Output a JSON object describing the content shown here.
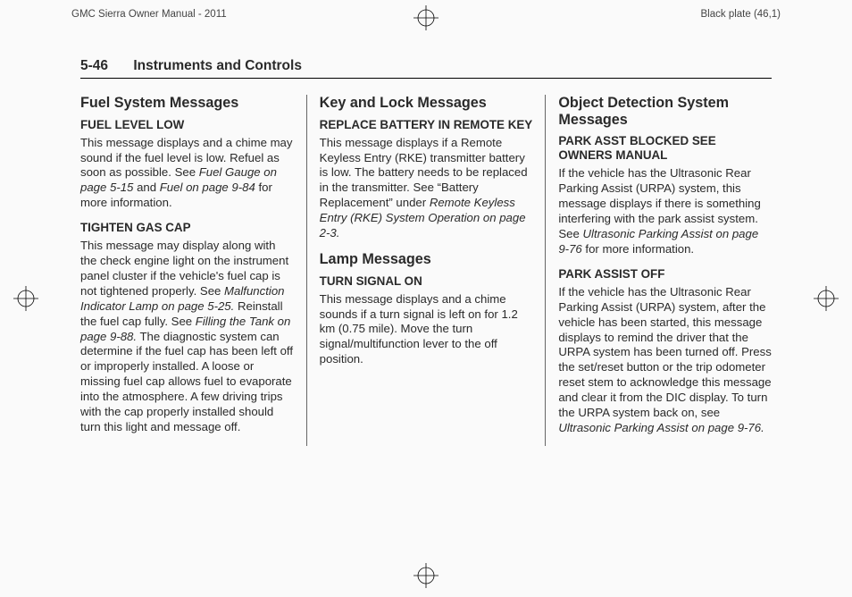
{
  "crop": {
    "left_label": "GMC Sierra Owner Manual - 2011",
    "right_label": "Black plate (46,1)"
  },
  "header": {
    "page_number": "5-46",
    "chapter": "Instruments and Controls"
  },
  "col1": {
    "h2a": "Fuel System Messages",
    "h3a": "FUEL LEVEL LOW",
    "p1a": "This message displays and a chime may sound if the fuel level is low. Refuel as soon as possible. See ",
    "p1_it1": "Fuel Gauge on page 5-15",
    "p1_mid": " and ",
    "p1_it2": "Fuel on page 9-84",
    "p1_end": " for more information.",
    "h3b": "TIGHTEN GAS CAP",
    "p2a": "This message may display along with the check engine light on the instrument panel cluster if the vehicle's fuel cap is not tightened properly. See ",
    "p2_it1": "Malfunction Indicator Lamp on page 5-25.",
    "p2_mid1": " Reinstall the fuel cap fully. See ",
    "p2_it2": "Filling the Tank on page 9-88.",
    "p2_end": " The diagnostic system can determine if the fuel cap has been left off or improperly installed. A loose or missing fuel cap allows fuel to evaporate into the atmosphere. A few driving trips with the cap properly installed should turn this light and message off."
  },
  "col2": {
    "h2a": "Key and Lock Messages",
    "h3a": "REPLACE BATTERY IN REMOTE KEY",
    "p1a": "This message displays if a Remote Keyless Entry (RKE) transmitter battery is low. The battery needs to be replaced in the transmitter. See “Battery Replacement” under ",
    "p1_it1": "Remote Keyless Entry (RKE) System Operation on page 2-3.",
    "h2b": "Lamp Messages",
    "h3b": "TURN SIGNAL ON",
    "p2": "This message displays and a chime sounds if a turn signal is left on for 1.2 km (0.75 mile). Move the turn signal/multifunction lever to the off position."
  },
  "col3": {
    "h2a": "Object Detection System Messages",
    "h3a": "PARK ASST BLOCKED SEE OWNERS MANUAL",
    "p1a": "If the vehicle has the Ultrasonic Rear Parking Assist (URPA) system, this message displays if there is something interfering with the park assist system. See ",
    "p1_it1": "Ultrasonic Parking Assist on page 9-76",
    "p1_end": " for more information.",
    "h3b": "PARK ASSIST OFF",
    "p2a": "If the vehicle has the Ultrasonic Rear Parking Assist (URPA) system, after the vehicle has been started, this message displays to remind the driver that the URPA system has been turned off. Press the set/reset button or the trip odometer reset stem to acknowledge this message and clear it from the DIC display. To turn the URPA system back on, see ",
    "p2_it1": "Ultrasonic Parking Assist on page 9-76."
  }
}
